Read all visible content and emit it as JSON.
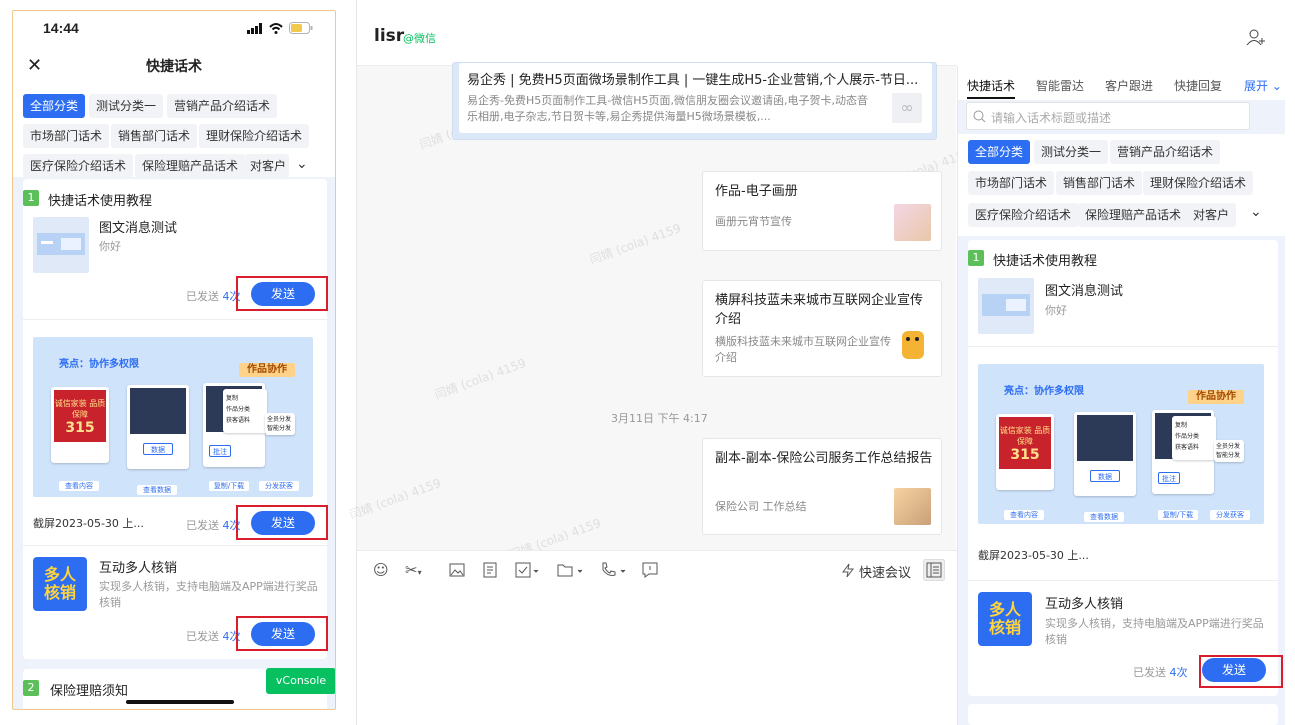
{
  "phone": {
    "time": "14:44",
    "nav_title": "快捷话术",
    "categories": [
      "全部分类",
      "测试分类一",
      "营销产品介绍话术",
      "市场部门话术",
      "销售部门话术",
      "理财保险介绍话术",
      "医疗保险介绍话术",
      "保险理赔产品话术",
      "对客户"
    ],
    "sections": [
      {
        "num": "1",
        "title": "快捷话术使用教程"
      },
      {
        "num": "2",
        "title": "保险理赔须知"
      }
    ],
    "items": [
      {
        "title": "图文消息测试",
        "desc": "你好",
        "sent_prefix": "已发送",
        "sent_count": "4次",
        "send_label": "发送"
      },
      {
        "caption": "截屏2023-05-30 上...",
        "sent_prefix": "已发送",
        "sent_count": "4次",
        "send_label": "发送"
      },
      {
        "title": "互动多人核销",
        "desc": "实现多人核销，支持电脑端及APP端进行奖品核销",
        "sent_prefix": "已发送",
        "sent_count": "4次",
        "send_label": "发送"
      }
    ],
    "vconsole": "vConsole"
  },
  "poster": {
    "highlight": "亮点：协作多权限",
    "tag": "作品协作",
    "red_text": "诚信家装 品质保障",
    "num": "315",
    "btn1": "查看内容",
    "btn2": "查看数据",
    "btn3": "复制/下载",
    "btn4": "分发获客",
    "menu": [
      "复制",
      "作品分类",
      "获客语料"
    ],
    "sub": [
      "全员分发",
      "智能分发"
    ],
    "data_label": "数据",
    "approve_label": "批注"
  },
  "qicon": {
    "line1": "多人",
    "line2": "核销"
  },
  "chat": {
    "name": "lisr",
    "wechat": "@微信",
    "messages": [
      {
        "title": "易企秀 | 免费H5页面微场景制作工具 | 一键生成H5-企业营销,个人展示-节日...",
        "desc": "易企秀-免费H5页面制作工具-微信H5页面,微信朋友圈会议邀请函,电子贺卡,动态音乐相册,电子杂志,节日贺卡等,易企秀提供海量H5微场景模板,..."
      },
      {
        "title": "作品-电子画册",
        "desc": "画册元宵节宣传"
      },
      {
        "title": "横屏科技蓝未来城市互联网企业宣传介绍",
        "desc": "横版科技蓝未来城市互联网企业宣传介绍"
      },
      {
        "title": "副本-副本-保险公司服务工作总结报告",
        "desc": "保险公司 工作总结"
      }
    ],
    "timestamp": "3月11日 下午 4:17",
    "quick_meeting": "快速会议",
    "watermark": "闫婧 (cola) 4159"
  },
  "right": {
    "tabs": [
      "快捷话术",
      "智能雷达",
      "客户跟进",
      "快捷回复"
    ],
    "expand": "展开",
    "search_placeholder": "请输入话术标题或描述",
    "categories": [
      "全部分类",
      "测试分类一",
      "营销产品介绍话术",
      "市场部门话术",
      "销售部门话术",
      "理财保险介绍话术",
      "医疗保险介绍话术",
      "保险理赔产品话术",
      "对客户"
    ],
    "section": {
      "num": "1",
      "title": "快捷话术使用教程"
    },
    "items": [
      {
        "title": "图文消息测试",
        "desc": "你好"
      },
      {
        "caption": "截屏2023-05-30 上..."
      },
      {
        "title": "互动多人核销",
        "desc": "实现多人核销，支持电脑端及APP端进行奖品核销",
        "sent_prefix": "已发送",
        "sent_count": "4次",
        "send_label": "发送"
      }
    ]
  }
}
